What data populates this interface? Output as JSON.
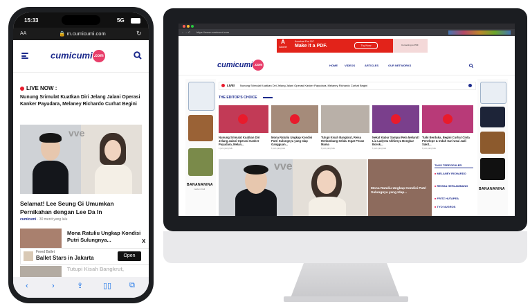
{
  "phone": {
    "status_time": "15:33",
    "status_signal": "5G",
    "url_aa": "AA",
    "url": "m.cumicumi.com",
    "logo_text": "cumicumi",
    "logo_com": ".com",
    "live_label": "LIVE NOW :",
    "live_headline": "Nunung Srimulat Kuatkan Diri Jelang Jalani Operasi Kanker Payudara, Melaney Richardo Curhat Begini",
    "hero_title": "Selamat! Lee Seung Gi Umumkan Pernikahan dengan Lee Da In",
    "hero_time": "30 menit yang lalu",
    "item_title": "Mona Ratuliu Ungkap Kondisi Putri Sulungnya...",
    "ad_title": "Freed Ballet",
    "ad_subtitle": "Ballet Stars in Jakarta",
    "ad_button": "Open",
    "ad_close": "X",
    "next_title": "Tutupi Kisah Bangkrut,"
  },
  "desktop": {
    "url": "https://www.cumicumi.com",
    "ad_brand": "Adobe",
    "ad_line1": "Acrobat Pro DC",
    "ad_line2": "Make it a PDF.",
    "ad_button": "Try Now",
    "ad_converting": "Converting to PDF",
    "logo_text": "cumicumi",
    "logo_com": ".com",
    "nav": [
      "HOME",
      "VIDEOS",
      "ARTICLES",
      "OUR NETWORKS"
    ],
    "live_label": "LIVE!",
    "live_headline": "Nunung Srimulat Kuatkan Diri Jelang Jalani Operasi Kanker Payudara, Melaney Richardo Curhat Begini",
    "editors_label": "THE EDITOR'S CHOICE",
    "cards": [
      {
        "title": "Nunung Srimulat Kuatkan Diri Jelang Jalani Operasi Kanker Payudara, Melan...",
        "thumb_color": "#c23a56"
      },
      {
        "title": "Mona Ratuliu Ungkap Kondisi Putri Sulungnya yang Idap Gangguan...",
        "thumb_color": "#a58b7a"
      },
      {
        "title": "Tutupi Kisah Bangkrut, Reisa Herlambang Selalu Ingat Pesan Mama",
        "thumb_color": "#b9b0a8"
      },
      {
        "title": "Nekat Kabur Sampai Rela Melarat! Lia Ladysta Akhirnya Bongkar Borok...",
        "thumb_color": "#7a3f8c"
      },
      {
        "title": "Tuiki Berduka, Begini Curhat Cinta Penelope & Indah Sari Usai Jadi Sakit...",
        "thumb_color": "#b83a78"
      }
    ],
    "card_time": "1 jam yang lalu",
    "feature_caption": "Mona Ratuliu Ungkap Kondisi Putri Sulungnya yang Idap...",
    "tags_label": "TAGS TERPOPULER",
    "tags": [
      "MELANEY RICHARDO",
      "REISSA HERLAMBANG",
      "FRITZ HUTAPEA",
      "TYO NUGROS"
    ],
    "side_brand": "BANANANINA",
    "side_brand_sub": "made in bali"
  },
  "colors": {
    "brand_blue": "#1c2a8c",
    "accent_pink": "#e83e6a",
    "live_red": "#e81b2c",
    "adobe_red": "#e2231a"
  }
}
